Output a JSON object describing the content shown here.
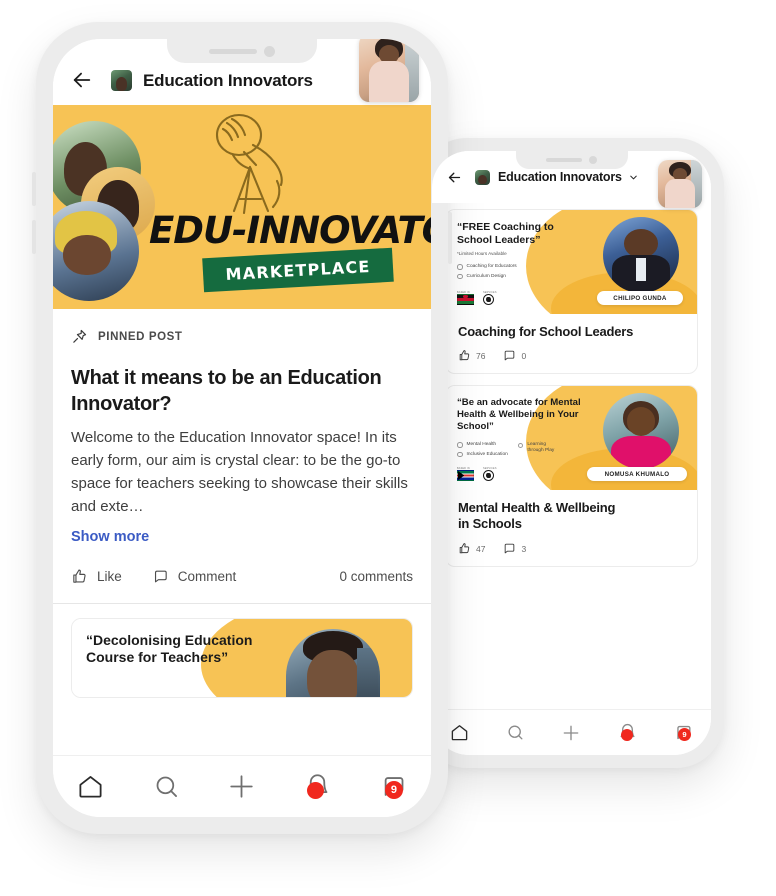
{
  "app": {
    "group_name": "Education Innovators",
    "back_icon": "back-arrow-icon",
    "chevron_icon": "chevron-down-icon"
  },
  "banner": {
    "word_top": "EDU-INNOVATOR",
    "ribbon": "MARKETPLACE",
    "bg_color": "#f7c355",
    "ribbon_color": "#156b3f"
  },
  "pinned_post": {
    "pin_label": "PINNED POST",
    "title": "What it means to be an Education Innovator?",
    "body": "Welcome to the Education Innovator space! In its early form, our aim is crystal clear: to be the go-to space for teachers seeking to showcase their skills and exte…",
    "show_more": "Show more",
    "like_label": "Like",
    "comment_label": "Comment",
    "comment_count_label": "0 comments"
  },
  "front_feed_card": {
    "headline": "“Decolonising Education Course for Teachers”"
  },
  "promo_cards": [
    {
      "headline": "“FREE Coaching to School Leaders”",
      "subhead": "*Limited Hours Available",
      "bullets": [
        "Coaching for Educators",
        "Curriculum Design"
      ],
      "presenter": "CHILIPO GUNDA",
      "flag_label": "BASED IN",
      "region_label": "SERVICES",
      "flag": "malawi-flag",
      "title": "Coaching for School Leaders",
      "likes": "76",
      "comments": "0"
    },
    {
      "headline": "“Be an advocate for Mental Health & Wellbeing in Your School”",
      "subhead": "",
      "bullets": [
        "Mental Health",
        "Learning through Play",
        "Inclusive Education"
      ],
      "presenter": "NOMUSA KHUMALO",
      "flag_label": "BASED IN",
      "region_label": "SERVICES",
      "flag": "south-africa-flag",
      "title": "Mental Health & Wellbeing in Schools",
      "likes": "47",
      "comments": "3"
    }
  ],
  "bottom_nav": {
    "items": [
      {
        "icon": "home-icon",
        "badge": ""
      },
      {
        "icon": "search-icon",
        "badge": ""
      },
      {
        "icon": "plus-icon",
        "badge": ""
      },
      {
        "icon": "bell-icon",
        "badge": ""
      },
      {
        "icon": "chat-bubble-icon",
        "badge": "9"
      }
    ],
    "badge_color": "#f0281e"
  }
}
